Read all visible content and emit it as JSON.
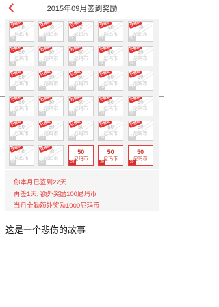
{
  "header": {
    "title": "2015年09月签到奖励"
  },
  "reward": {
    "amount": "50",
    "unit": "尼玛币",
    "stamp_label": "已领取"
  },
  "days": [
    {
      "day": "1",
      "status": "claimed"
    },
    {
      "day": "2",
      "status": "claimed"
    },
    {
      "day": "3",
      "status": "claimed"
    },
    {
      "day": "4",
      "status": "claimed"
    },
    {
      "day": "5",
      "status": "claimed"
    },
    {
      "day": "6",
      "status": "claimed"
    },
    {
      "day": "7",
      "status": "claimed"
    },
    {
      "day": "8",
      "status": "claimed"
    },
    {
      "day": "9",
      "status": "claimed"
    },
    {
      "day": "10",
      "status": "claimed"
    },
    {
      "day": "11",
      "status": "claimed"
    },
    {
      "day": "12",
      "status": "claimed"
    },
    {
      "day": "13",
      "status": "claimed"
    },
    {
      "day": "14",
      "status": "claimed"
    },
    {
      "day": "15",
      "status": "claimed"
    },
    {
      "day": "16",
      "status": "claimed"
    },
    {
      "day": "17",
      "status": "claimed"
    },
    {
      "day": "18",
      "status": "claimed"
    },
    {
      "day": "19",
      "status": "claimed"
    },
    {
      "day": "20",
      "status": "claimed"
    },
    {
      "day": "21",
      "status": "claimed"
    },
    {
      "day": "22",
      "status": "claimed"
    },
    {
      "day": "23",
      "status": "claimed"
    },
    {
      "day": "24",
      "status": "claimed"
    },
    {
      "day": "25",
      "status": "claimed"
    },
    {
      "day": "26",
      "status": "claimed"
    },
    {
      "day": "27",
      "status": "claimed"
    },
    {
      "day": "28",
      "status": "pending"
    },
    {
      "day": "29",
      "status": "pending"
    },
    {
      "day": "30",
      "status": "pending"
    }
  ],
  "info": {
    "line1": "你本月已签到27天",
    "line2": "再签1天, 额外奖励100尼玛币",
    "line3": "当月全勤额外奖励1000尼玛币"
  },
  "story": {
    "text": "这是一个悲伤的故事"
  },
  "colors": {
    "accent": "#e53935",
    "stamp": "#ea2f2f",
    "muted": "#c8c8c8"
  }
}
